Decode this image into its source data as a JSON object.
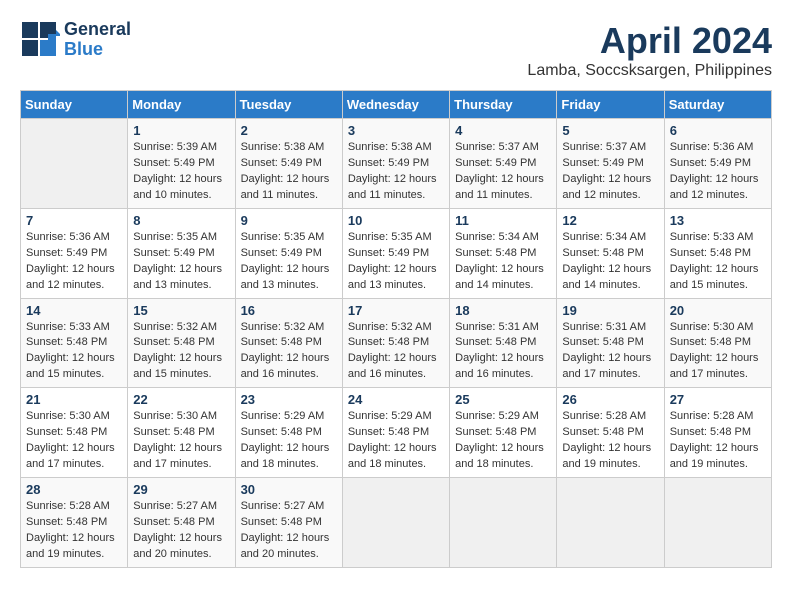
{
  "header": {
    "logo_general": "General",
    "logo_blue": "Blue",
    "month_year": "April 2024",
    "location": "Lamba, Soccsksargen, Philippines"
  },
  "columns": [
    "Sunday",
    "Monday",
    "Tuesday",
    "Wednesday",
    "Thursday",
    "Friday",
    "Saturday"
  ],
  "weeks": [
    [
      {
        "day": "",
        "info": ""
      },
      {
        "day": "1",
        "info": "Sunrise: 5:39 AM\nSunset: 5:49 PM\nDaylight: 12 hours\nand 10 minutes."
      },
      {
        "day": "2",
        "info": "Sunrise: 5:38 AM\nSunset: 5:49 PM\nDaylight: 12 hours\nand 11 minutes."
      },
      {
        "day": "3",
        "info": "Sunrise: 5:38 AM\nSunset: 5:49 PM\nDaylight: 12 hours\nand 11 minutes."
      },
      {
        "day": "4",
        "info": "Sunrise: 5:37 AM\nSunset: 5:49 PM\nDaylight: 12 hours\nand 11 minutes."
      },
      {
        "day": "5",
        "info": "Sunrise: 5:37 AM\nSunset: 5:49 PM\nDaylight: 12 hours\nand 12 minutes."
      },
      {
        "day": "6",
        "info": "Sunrise: 5:36 AM\nSunset: 5:49 PM\nDaylight: 12 hours\nand 12 minutes."
      }
    ],
    [
      {
        "day": "7",
        "info": "Sunrise: 5:36 AM\nSunset: 5:49 PM\nDaylight: 12 hours\nand 12 minutes."
      },
      {
        "day": "8",
        "info": "Sunrise: 5:35 AM\nSunset: 5:49 PM\nDaylight: 12 hours\nand 13 minutes."
      },
      {
        "day": "9",
        "info": "Sunrise: 5:35 AM\nSunset: 5:49 PM\nDaylight: 12 hours\nand 13 minutes."
      },
      {
        "day": "10",
        "info": "Sunrise: 5:35 AM\nSunset: 5:49 PM\nDaylight: 12 hours\nand 13 minutes."
      },
      {
        "day": "11",
        "info": "Sunrise: 5:34 AM\nSunset: 5:48 PM\nDaylight: 12 hours\nand 14 minutes."
      },
      {
        "day": "12",
        "info": "Sunrise: 5:34 AM\nSunset: 5:48 PM\nDaylight: 12 hours\nand 14 minutes."
      },
      {
        "day": "13",
        "info": "Sunrise: 5:33 AM\nSunset: 5:48 PM\nDaylight: 12 hours\nand 15 minutes."
      }
    ],
    [
      {
        "day": "14",
        "info": "Sunrise: 5:33 AM\nSunset: 5:48 PM\nDaylight: 12 hours\nand 15 minutes."
      },
      {
        "day": "15",
        "info": "Sunrise: 5:32 AM\nSunset: 5:48 PM\nDaylight: 12 hours\nand 15 minutes."
      },
      {
        "day": "16",
        "info": "Sunrise: 5:32 AM\nSunset: 5:48 PM\nDaylight: 12 hours\nand 16 minutes."
      },
      {
        "day": "17",
        "info": "Sunrise: 5:32 AM\nSunset: 5:48 PM\nDaylight: 12 hours\nand 16 minutes."
      },
      {
        "day": "18",
        "info": "Sunrise: 5:31 AM\nSunset: 5:48 PM\nDaylight: 12 hours\nand 16 minutes."
      },
      {
        "day": "19",
        "info": "Sunrise: 5:31 AM\nSunset: 5:48 PM\nDaylight: 12 hours\nand 17 minutes."
      },
      {
        "day": "20",
        "info": "Sunrise: 5:30 AM\nSunset: 5:48 PM\nDaylight: 12 hours\nand 17 minutes."
      }
    ],
    [
      {
        "day": "21",
        "info": "Sunrise: 5:30 AM\nSunset: 5:48 PM\nDaylight: 12 hours\nand 17 minutes."
      },
      {
        "day": "22",
        "info": "Sunrise: 5:30 AM\nSunset: 5:48 PM\nDaylight: 12 hours\nand 17 minutes."
      },
      {
        "day": "23",
        "info": "Sunrise: 5:29 AM\nSunset: 5:48 PM\nDaylight: 12 hours\nand 18 minutes."
      },
      {
        "day": "24",
        "info": "Sunrise: 5:29 AM\nSunset: 5:48 PM\nDaylight: 12 hours\nand 18 minutes."
      },
      {
        "day": "25",
        "info": "Sunrise: 5:29 AM\nSunset: 5:48 PM\nDaylight: 12 hours\nand 18 minutes."
      },
      {
        "day": "26",
        "info": "Sunrise: 5:28 AM\nSunset: 5:48 PM\nDaylight: 12 hours\nand 19 minutes."
      },
      {
        "day": "27",
        "info": "Sunrise: 5:28 AM\nSunset: 5:48 PM\nDaylight: 12 hours\nand 19 minutes."
      }
    ],
    [
      {
        "day": "28",
        "info": "Sunrise: 5:28 AM\nSunset: 5:48 PM\nDaylight: 12 hours\nand 19 minutes."
      },
      {
        "day": "29",
        "info": "Sunrise: 5:27 AM\nSunset: 5:48 PM\nDaylight: 12 hours\nand 20 minutes."
      },
      {
        "day": "30",
        "info": "Sunrise: 5:27 AM\nSunset: 5:48 PM\nDaylight: 12 hours\nand 20 minutes."
      },
      {
        "day": "",
        "info": ""
      },
      {
        "day": "",
        "info": ""
      },
      {
        "day": "",
        "info": ""
      },
      {
        "day": "",
        "info": ""
      }
    ]
  ]
}
